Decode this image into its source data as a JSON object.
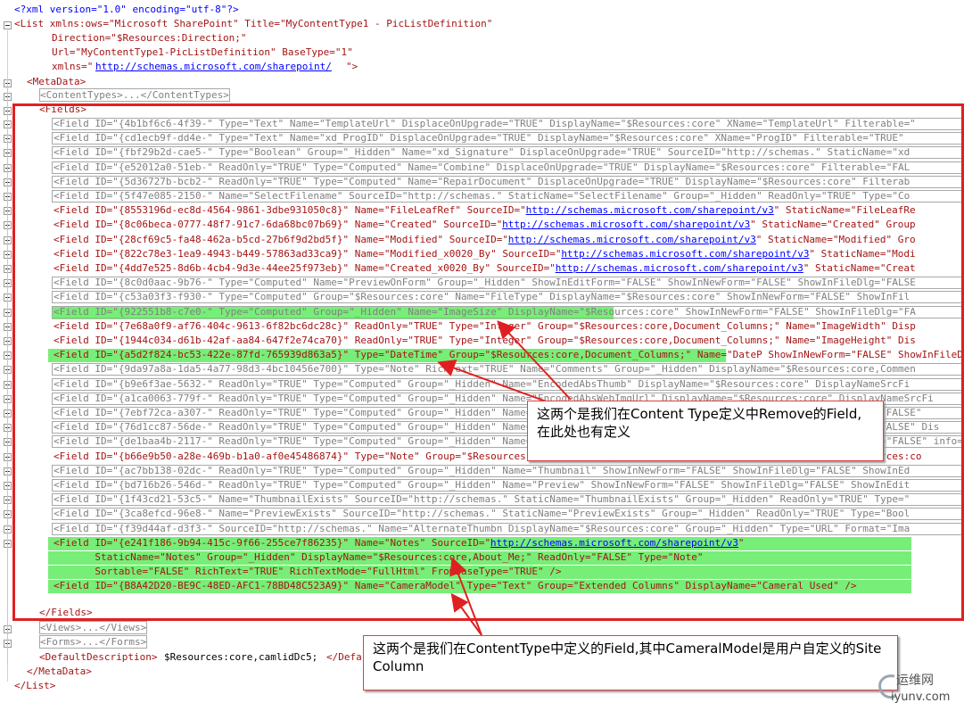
{
  "editor": {
    "xml_decl": "<?xml version=\"1.0\" encoding=\"utf-8\"?>",
    "list_open": "<List xmlns:ows=\"Microsoft SharePoint\" Title=\"MyContentType1 - PicListDefinition\"",
    "list_direction": "Direction=\"$Resources:Direction;\"",
    "list_url_attr": "Url=\"MyContentType1-PicListDefinition\" BaseType=\"1\"",
    "list_xmlns_label": "xmlns=\"",
    "list_xmlns_url": "http://schemas.microsoft.com/sharepoint/",
    "list_xmlns_end": "\">",
    "metadata_open": "<MetaData>",
    "content_types": "<ContentTypes>...</ContentTypes>",
    "fields_open": "<Fields>",
    "fields_close": "</Fields>",
    "views": "<Views>...</Views>",
    "forms": "<Forms>...</Forms>",
    "default_desc_open": "<DefaultDescription>",
    "default_desc_text": "$Resources:core,camlidDc5;",
    "default_desc_close": "</Defa",
    "metadata_close": "</MetaData>",
    "list_close": "</List>",
    "field_lines": [
      {
        "pre": "<Field ID=\"{4b1bf6c6-4f39-\" Type=\"Text\" Name=\"TemplateUrl\" DisplaceOnUpgrade=\"TRUE\" DisplayName=\"$Resources:core\" XName=\"TemplateUrl\" Filterable=\"",
        "url": "",
        "post": ""
      },
      {
        "pre": "<Field ID=\"{cd1ecb9f-dd4e-\" Type=\"Text\" Name=\"xd_ProgID\" DisplaceOnUpgrade=\"TRUE\" DisplayName=\"$Resources:core\" XName=\"ProgID\" Filterable=\"TRUE\" ",
        "url": "",
        "post": ""
      },
      {
        "pre": "<Field ID=\"{fbf29b2d-cae5-\" Type=\"Boolean\" Group=\"_Hidden\" Name=\"xd_Signature\" DisplaceOnUpgrade=\"TRUE\" SourceID=\"http://schemas.\" StaticName=\"xd",
        "url": "",
        "post": ""
      },
      {
        "pre": "<Field ID=\"{e52012a0-51eb-\" ReadOnly=\"TRUE\" Type=\"Computed\" Name=\"Combine\" DisplaceOnUpgrade=\"TRUE\" DisplayName=\"$Resources:core\" Filterable=\"FAL",
        "url": "",
        "post": ""
      },
      {
        "pre": "<Field ID=\"{5d36727b-bcb2-\" ReadOnly=\"TRUE\" Type=\"Computed\" Name=\"RepairDocument\" DisplaceOnUpgrade=\"TRUE\" DisplayName=\"$Resources:core\" Filterab",
        "url": "",
        "post": ""
      },
      {
        "pre": "<Field ID=\"{5f47e085-2150-\" Name=\"SelectFilename\" SourceID=\"http://schemas.\" StaticName=\"SelectFilename\" Group=\"_Hidden\" ReadOnly=\"TRUE\" Type=\"Co",
        "url": "",
        "post": ""
      },
      {
        "pre": "<Field ID=\"{8553196d-ec8d-4564-9861-3dbe931050c8}\" Name=\"FileLeafRef\" SourceID=\"",
        "url": "http://schemas.microsoft.com/sharepoint/v3",
        "post": "\" StaticName=\"FileLeafRe"
      },
      {
        "pre": "<Field ID=\"{8c06beca-0777-48f7-91c7-6da68bc07b69}\" Name=\"Created\" SourceID=\"",
        "url": "http://schemas.microsoft.com/sharepoint/v3",
        "post": "\" StaticName=\"Created\" Group"
      },
      {
        "pre": "<Field ID=\"{28cf69c5-fa48-462a-b5cd-27b6f9d2bd5f}\" Name=\"Modified\" SourceID=\"",
        "url": "http://schemas.microsoft.com/sharepoint/v3",
        "post": "\" StaticName=\"Modified\" Gro"
      },
      {
        "pre": "<Field ID=\"{822c78e3-1ea9-4943-b449-57863ad33ca9}\" Name=\"Modified_x0020_By\" SourceID=\"",
        "url": "http://schemas.microsoft.com/sharepoint/v3",
        "post": "\" StaticName=\"Modi"
      },
      {
        "pre": "<Field ID=\"{4dd7e525-8d6b-4cb4-9d3e-44ee25f973eb}\" Name=\"Created_x0020_By\" SourceID=\"",
        "url": "http://schemas.microsoft.com/sharepoint/v3",
        "post": "\" StaticName=\"Creat"
      },
      {
        "pre": "<Field ID=\"{8c0d0aac-9b76-\" Type=\"Computed\" Name=\"PreviewOnForm\" Group=\"_Hidden\" ShowInEditForm=\"FALSE\" ShowInNewForm=\"FALSE\" ShowInFileDlg=\"FALSE",
        "url": "",
        "post": ""
      },
      {
        "pre": "<Field ID=\"{c53a03f3-f930-\" Type=\"Computed\" Group=\"$Resources:core\" Name=\"FileType\" DisplayName=\"$Resources:core\" ShowInNewForm=\"FALSE\" ShowInFil",
        "url": "",
        "post": ""
      },
      {
        "pre": "<Field ID=\"{922551b8-c7e0-\" Type=\"Computed\" Group=\"_Hidden\" Name=\"ImageSize\" DisplayName=\"$Resources:core\" ShowInNewForm=\"FALSE\" ShowInFileDlg=\"FA",
        "url": "",
        "post": ""
      },
      {
        "pre": "<Field ID=\"{7e68a0f9-af76-404c-9613-6f82bc6dc28c}\" ReadOnly=\"TRUE\" Type=\"Integer\" Group=\"$Resources:core,Document_Columns;\" Name=\"ImageWidth\" Disp",
        "url": "",
        "post": ""
      },
      {
        "pre": "<Field ID=\"{1944c034-d61b-42af-aa84-647f2e74ca70}\" ReadOnly=\"TRUE\" Type=\"Integer\" Group=\"$Resources:core,Document_Columns;\" Name=\"ImageHeight\" Dis",
        "url": "",
        "post": ""
      },
      {
        "pre": "<Field ID=\"{a5d2f824-bc53-422e-87fd-765939d863a5}\" Type=\"DateTime\" Group=\"$Resources:core,Document_Columns;\" Name=\"DateP ShowInNewForm=\"FALSE\" ShowInFileDlg=\"",
        "url": "",
        "post": ""
      },
      {
        "pre": "<Field ID=\"{9da97a8a-1da5-4a77-98d3-4bc10456e700}\" Type=\"Note\" RichText=\"TRUE\" Name=\"Comments\" Group=\"_Hidden\" DisplayName=\"$Resources:core,Commen",
        "url": "",
        "post": ""
      },
      {
        "pre": "<Field ID=\"{b9e6f3ae-5632-\" ReadOnly=\"TRUE\" Type=\"Computed\" Group=\"_Hidden\" Name=\"EncodedAbsThumb\" DisplayName=\"$Resources:core\" DisplayNameSrcFi",
        "url": "",
        "post": ""
      },
      {
        "pre": "<Field ID=\"{a1ca0063-779f-\" ReadOnly=\"TRUE\" Type=\"Computed\" Group=\"_Hidden\" Name=\"EncodedAbsWebImgUrl\" DisplayName=\"$Resources:core\" DisplayNameSrcFi",
        "url": "",
        "post": ""
      },
      {
        "pre": "<Field ID=\"{7ebf72ca-a307-\" ReadOnly=\"TRUE\" Type=\"Computed\" Group=\"_Hidden\" Name=\"SelectedFlag\" DisplayName=\"$Resources:core\" ShowInNewForm=\"FALSE\" ",
        "url": "",
        "post": ""
      },
      {
        "pre": "<Field ID=\"{76d1cc87-56de-\" ReadOnly=\"TRUE\" Type=\"Computed\" Group=\"_Hidden\" Name=\"NameOrTitle\" DisplayName=\"$Resources:core\" ShowInNewForm=\"FALSE\" Dis",
        "url": "",
        "post": ""
      },
      {
        "pre": "<Field ID=\"{de1baa4b-2117-\" ReadOnly=\"TRUE\" Type=\"Computed\" Group=\"_Hidden\" Name=\"RequiredField\" DisplayName=\"$Resources:core\" ShowInNewForm=\"FALSE\" info=\"$Res",
        "url": "",
        "post": ""
      },
      {
        "pre": "<Field ID=\"{b66e9b50-a28e-469b-b1a0-af0e45486874}\" Type=\"Note\" Group=\"$Resources:core,Document_Columns;\" Name=\"Keywords\" DisplayName=\"$Resources:co",
        "url": "",
        "post": ""
      },
      {
        "pre": "<Field ID=\"{ac7bb138-02dc-\" ReadOnly=\"TRUE\" Type=\"Computed\" Group=\"_Hidden\" Name=\"Thumbnail\" ShowInNewForm=\"FALSE\" ShowInFileDlg=\"FALSE\" ShowInEd",
        "url": "",
        "post": ""
      },
      {
        "pre": "<Field ID=\"{bd716b26-546d-\" ReadOnly=\"TRUE\" Type=\"Computed\" Group=\"_Hidden\" Name=\"Preview\" ShowInNewForm=\"FALSE\" ShowInFileDlg=\"FALSE\" ShowInEdit",
        "url": "",
        "post": ""
      },
      {
        "pre": "<Field ID=\"{1f43cd21-53c5-\" Name=\"ThumbnailExists\" SourceID=\"http://schemas.\" StaticName=\"ThumbnailExists\" Group=\"_Hidden\" ReadOnly=\"TRUE\" Type=\"",
        "url": "",
        "post": ""
      },
      {
        "pre": "<Field ID=\"{3ca8efcd-96e8-\" Name=\"PreviewExists\" SourceID=\"http://schemas.\" StaticName=\"PreviewExists\" Group=\"_Hidden\" ReadOnly=\"TRUE\" Type=\"Bool",
        "url": "",
        "post": ""
      },
      {
        "pre": "<Field ID=\"{f39d44af-d3f3-\" SourceID=\"http://schemas.\" Name=\"AlternateThumbn DisplayName=\"$Resources:core\" Group=\"_Hidden\" Type=\"URL\" Format=\"Ima",
        "url": "",
        "post": ""
      },
      {
        "pre": "<Field ID=\"{e241f186-9b94-415c-9f66-255ce7f86235}\" Name=\"Notes\" SourceID=\"",
        "url": "http://schemas.microsoft.com/sharepoint/v3",
        "post": "\""
      },
      {
        "pre": "       StaticName=\"Notes\" Group=\"_Hidden\" DisplayName=\"$Resources:core,About_Me;\" ReadOnly=\"FALSE\" Type=\"Note\"",
        "url": "",
        "post": ""
      },
      {
        "pre": "       Sortable=\"FALSE\" RichText=\"TRUE\" RichTextMode=\"FullHtml\" FromBaseType=\"TRUE\" />",
        "url": "",
        "post": ""
      },
      {
        "pre": "<Field ID=\"{B8A42D20-BE9C-48ED-AFC1-78BD48C523A9}\" Name=\"CameraModel\" Type=\"Text\" Group=\"Extended Columns\" DisplayName=\"Cameral Used\" />",
        "url": "",
        "post": ""
      }
    ]
  },
  "annotations": {
    "callout1": "这两个是我们在Content Type定义中Remove的Field,在此处也有定义",
    "callout2": "这两个是我们在ContentType中定义的Field,其中CameralModel是用户自定义的Site Column"
  },
  "watermark": {
    "name": "运维网",
    "url": "iyunv.com"
  },
  "colors": {
    "highlight": "#77ee77",
    "annotation_red": "#e02020",
    "xml_tag": "#a31515",
    "url_blue": "#0000ff"
  }
}
